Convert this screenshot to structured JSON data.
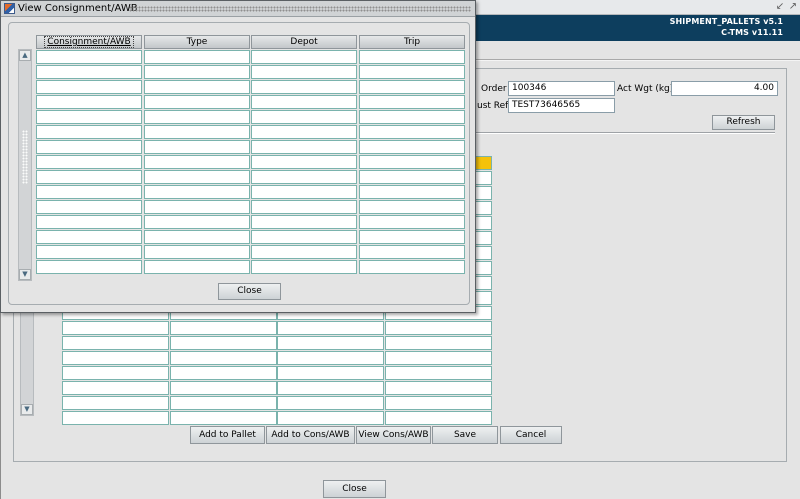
{
  "app": {
    "header_line1": "SHIPMENT_PALLETS v5.1",
    "header_line2": "C-TMS v11.11",
    "titlebar_icons": [
      "restore-icon",
      "maximize-icon"
    ]
  },
  "form": {
    "order_label": "Order",
    "order_value": "100346",
    "cust_ref_label": "ust Ref",
    "cust_ref_value": "TEST73646565",
    "act_wgt_label": "Act Wgt (kg)",
    "act_wgt_value": "4.00",
    "refresh_label": "Refresh"
  },
  "buttons": {
    "add_to_pallet": "Add to Pallet",
    "add_to_cons": "Add to Cons/AWB",
    "view_cons": "View Cons/AWB",
    "save": "Save",
    "cancel": "Cancel",
    "close": "Close"
  },
  "main_grid": {
    "visible_rows": 18,
    "columns": 4,
    "selected_row_index": 0,
    "selected_col_index": 3
  },
  "dialog": {
    "title": "View Consignment/AWB",
    "columns": [
      "Consignment/AWB",
      "Type",
      "Depot",
      "Trip"
    ],
    "rows": [
      [
        "",
        "",
        "",
        ""
      ],
      [
        "",
        "",
        "",
        ""
      ],
      [
        "",
        "",
        "",
        ""
      ],
      [
        "",
        "",
        "",
        ""
      ],
      [
        "",
        "",
        "",
        ""
      ],
      [
        "",
        "",
        "",
        ""
      ],
      [
        "",
        "",
        "",
        ""
      ],
      [
        "",
        "",
        "",
        ""
      ],
      [
        "",
        "",
        "",
        ""
      ],
      [
        "",
        "",
        "",
        ""
      ],
      [
        "",
        "",
        "",
        ""
      ],
      [
        "",
        "",
        "",
        ""
      ],
      [
        "",
        "",
        "",
        ""
      ],
      [
        "",
        "",
        "",
        ""
      ],
      [
        "",
        "",
        "",
        ""
      ]
    ],
    "close_label": "Close"
  },
  "colors": {
    "header_bg": "#0d3e5e",
    "selection": "#f5c20a",
    "grid_border": "#7ab3ad"
  }
}
